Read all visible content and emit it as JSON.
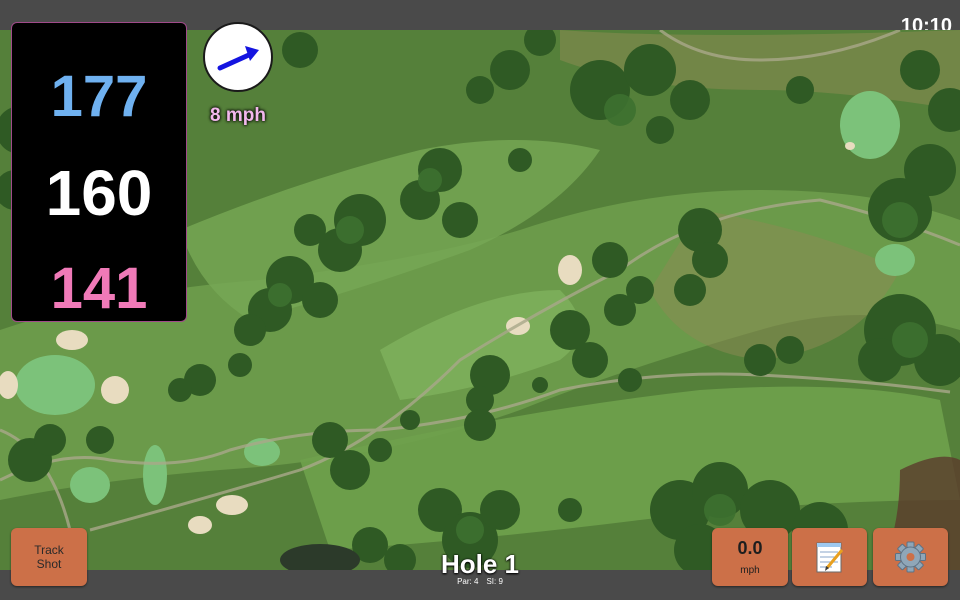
{
  "status_bar": {
    "clock": "10:10"
  },
  "distances": {
    "back": "177",
    "middle": "160",
    "front": "141"
  },
  "wind": {
    "speed_label": "8 mph",
    "direction": "east-northeast"
  },
  "hole": {
    "title": "Hole 1",
    "par_label": "Par: 4",
    "si_label": "SI: 9"
  },
  "buttons": {
    "track_shot": "Track Shot",
    "speed_value": "0.0",
    "speed_unit": "mph",
    "notes_icon": "notepad-icon",
    "settings_icon": "gear-icon"
  },
  "colors": {
    "back_distance": "#6fb1f0",
    "middle_distance": "#ffffff",
    "front_distance": "#f07ab8",
    "button_fill": "#cc7048",
    "wind_label": "#f2b8ec"
  }
}
